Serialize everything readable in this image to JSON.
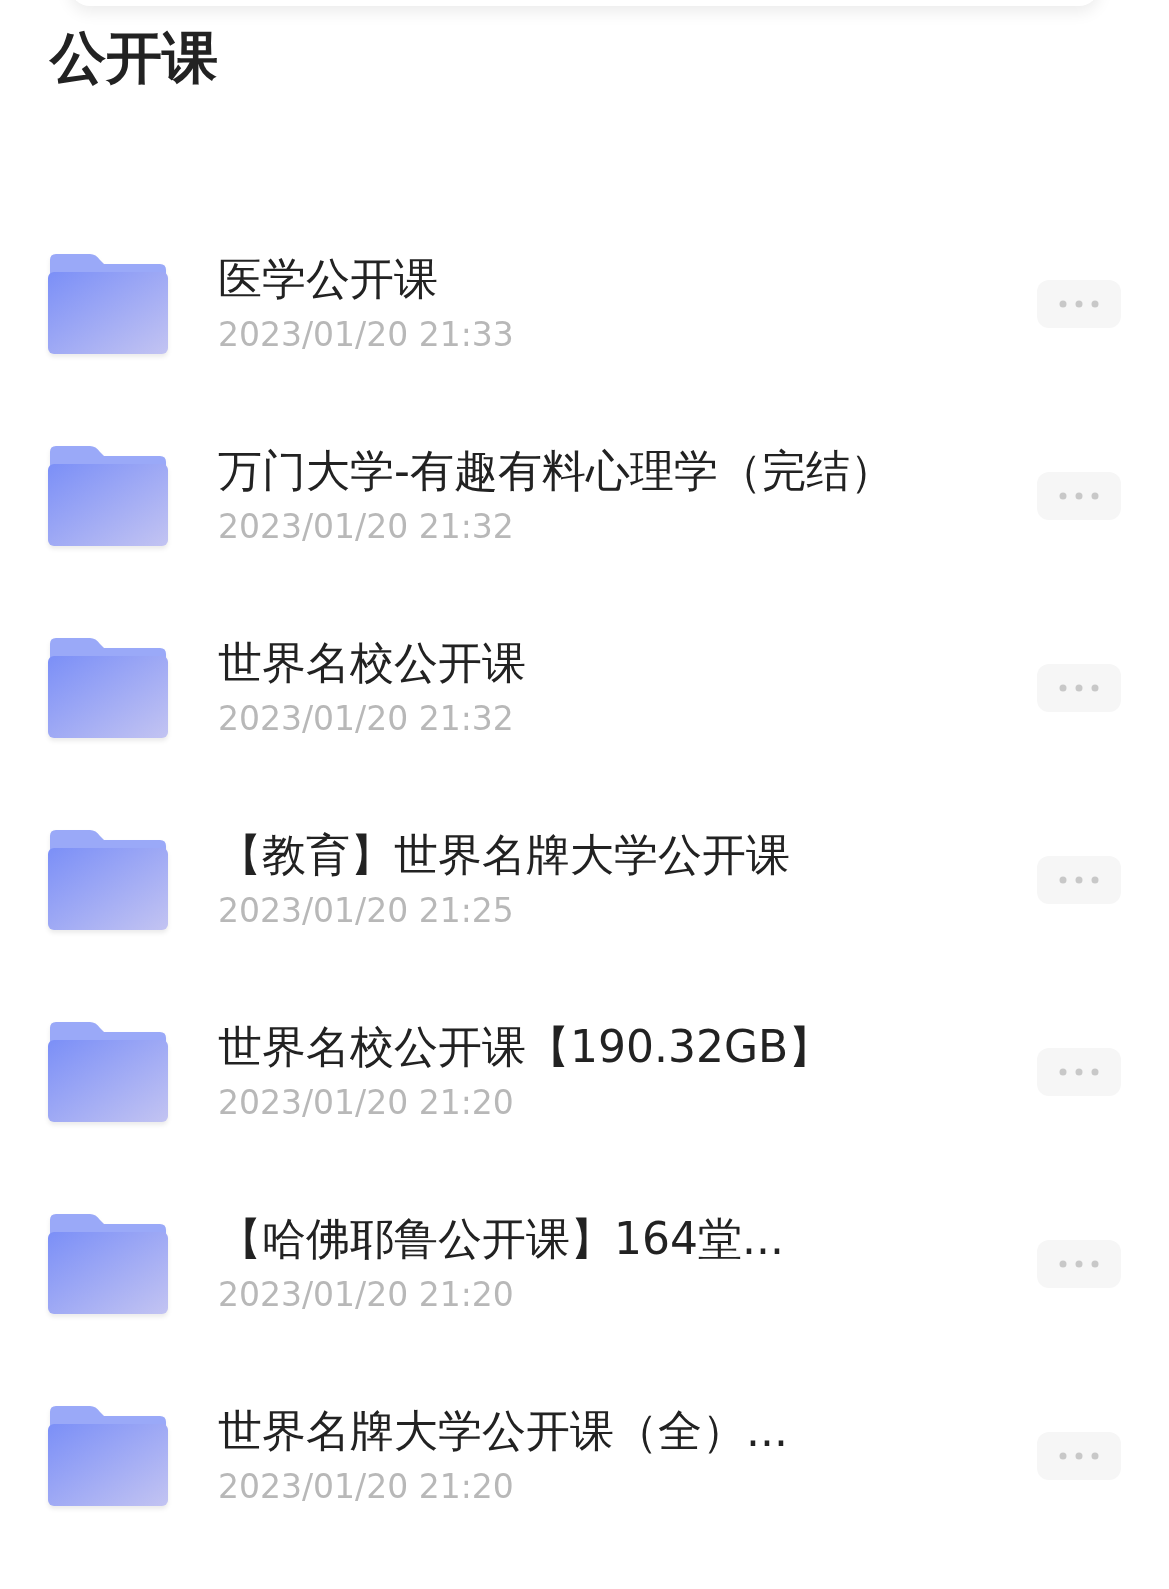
{
  "title": "公开课",
  "folders": [
    {
      "name": "医学公开课",
      "date": "2023/01/20 21:33"
    },
    {
      "name": "万门大学-有趣有料心理学（完结）",
      "date": "2023/01/20 21:32"
    },
    {
      "name": "世界名校公开课",
      "date": "2023/01/20 21:32"
    },
    {
      "name": "【教育】世界名牌大学公开课",
      "date": "2023/01/20 21:25"
    },
    {
      "name": "世界名校公开课【190.32GB】",
      "date": "2023/01/20 21:20"
    },
    {
      "name": "【哈佛耶鲁公开课】164堂...",
      "date": "2023/01/20 21:20"
    },
    {
      "name": "世界名牌大学公开课（全）...",
      "date": "2023/01/20 21:20"
    }
  ]
}
